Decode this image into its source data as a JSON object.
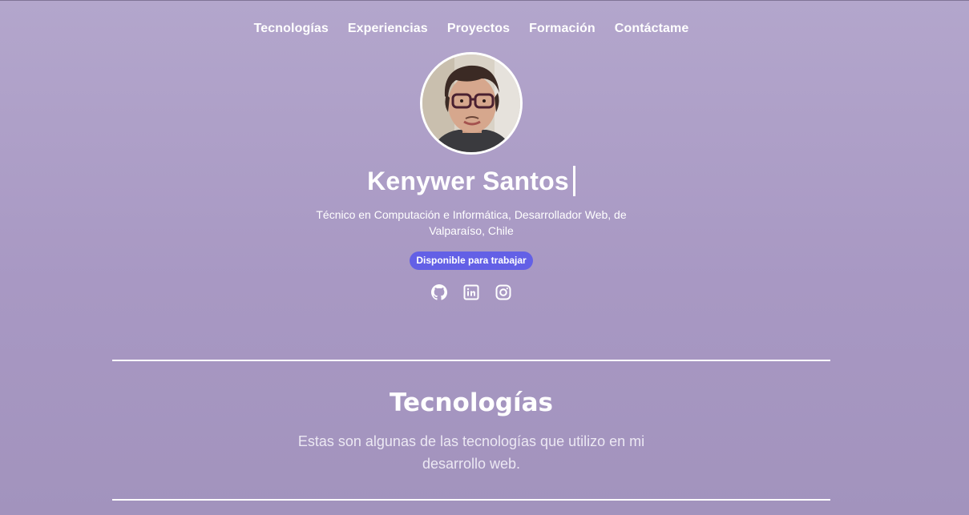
{
  "nav": {
    "items": [
      {
        "label": "Tecnologías"
      },
      {
        "label": "Experiencias"
      },
      {
        "label": "Proyectos"
      },
      {
        "label": "Formación"
      },
      {
        "label": "Contáctame"
      }
    ]
  },
  "profile": {
    "name": "Kenywer Santos",
    "subtitle": "Técnico en Computación e Informática, Desarrollador Web, de Valparaíso, Chile",
    "badge": "Disponible para trabajar",
    "social": [
      {
        "icon": "github-icon"
      },
      {
        "icon": "linkedin-icon"
      },
      {
        "icon": "instagram-icon"
      }
    ]
  },
  "technologies": {
    "title": "Tecnologías",
    "description": "Estas son algunas de las tecnologías que utilizo en mi desarrollo web."
  },
  "colors": {
    "background_top": "#b3a6cc",
    "background_bottom": "#a293bd",
    "badge": "#6360e6",
    "text": "#ffffff"
  }
}
